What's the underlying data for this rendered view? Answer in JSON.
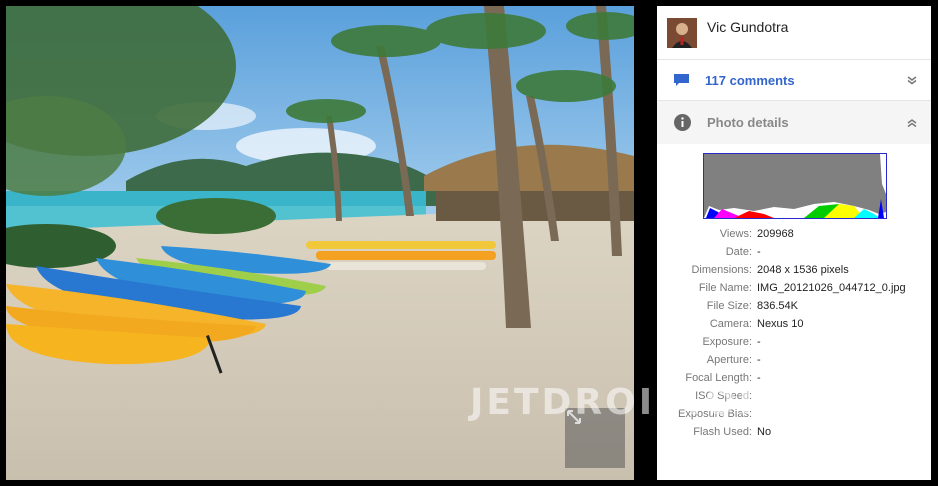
{
  "author": {
    "name": "Vic Gundotra"
  },
  "comments": {
    "label": "117 comments"
  },
  "photo_details": {
    "label": "Photo details",
    "rows": [
      {
        "key": "Views:",
        "value": "209968"
      },
      {
        "key": "Date:",
        "value": "-"
      },
      {
        "key": "Dimensions:",
        "value": "2048 x 1536 pixels"
      },
      {
        "key": "File Name:",
        "value": "IMG_20121026_044712_0.jpg"
      },
      {
        "key": "File Size:",
        "value": "836.54K"
      },
      {
        "key": "Camera:",
        "value": "Nexus 10"
      },
      {
        "key": "Exposure:",
        "value": "-"
      },
      {
        "key": "Aperture:",
        "value": "-"
      },
      {
        "key": "Focal Length:",
        "value": "-"
      },
      {
        "key": "ISO Speed:",
        "value": ""
      },
      {
        "key": "Exposure Bias:",
        "value": ""
      },
      {
        "key": "Flash Used:",
        "value": "No"
      }
    ]
  },
  "watermark": "JETDROID.ORG",
  "icons": {
    "comment": "comment-bubble-icon",
    "info": "info-icon",
    "expand": "expand-arrows-icon",
    "chevron_down": "chevron-double-down-icon",
    "chevron_up": "chevron-double-up-icon"
  },
  "colors": {
    "link": "#3366cc",
    "histogram_border": "#2a2acc",
    "histogram_fill": "#808080"
  }
}
